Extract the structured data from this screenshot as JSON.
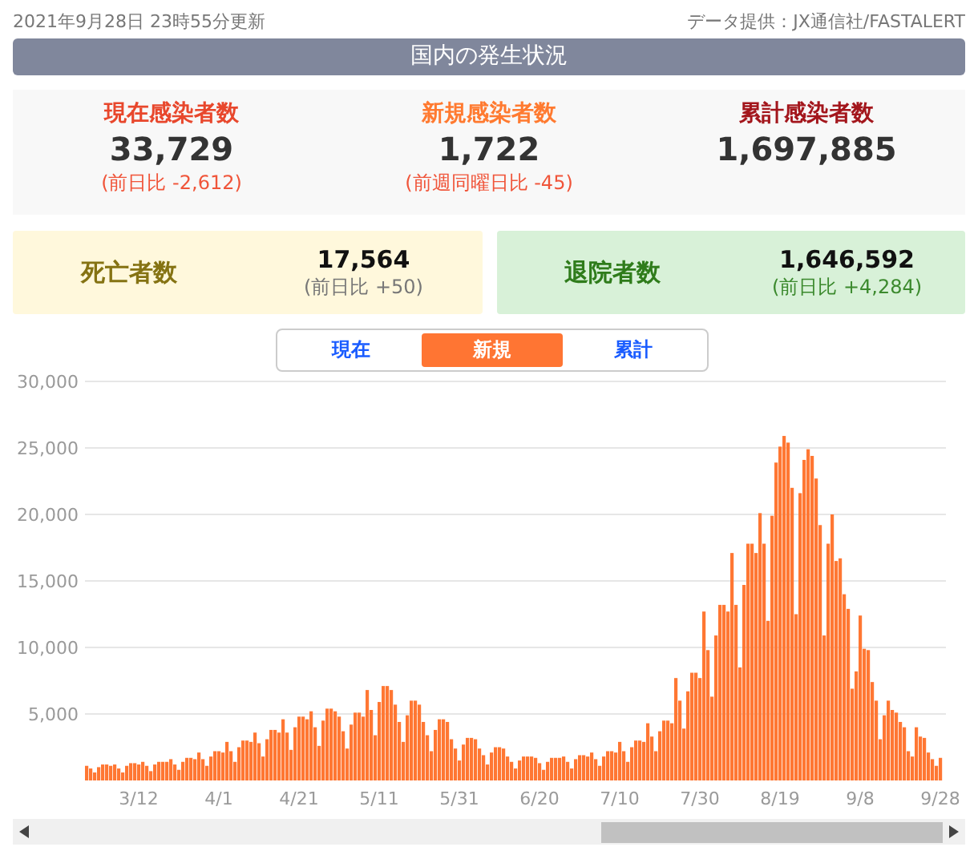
{
  "updated": "2021年9月28日 23時55分更新",
  "source": "データ提供：JX通信社/FASTALERT",
  "section_title": "国内の発生状況",
  "stats": [
    {
      "label": "現在感染者数",
      "value": "33,729",
      "delta": "(前日比 -2,612)",
      "color": "#e8472c"
    },
    {
      "label": "新規感染者数",
      "value": "1,722",
      "delta": "(前週同曜日比 -45)",
      "color": "#ff7a30"
    },
    {
      "label": "累計感染者数",
      "value": "1,697,885",
      "color": "#a3161c"
    }
  ],
  "outcomes": [
    {
      "kind": "death",
      "label": "死亡者数",
      "value": "17,564",
      "delta": "(前日比 +50)"
    },
    {
      "kind": "recovered",
      "label": "退院者数",
      "value": "1,646,592",
      "delta": "(前日比 +4,284)"
    }
  ],
  "view_tabs": [
    {
      "label": "現在",
      "selected": false
    },
    {
      "label": "新規",
      "selected": true
    },
    {
      "label": "累計",
      "selected": false
    }
  ],
  "chart": {
    "chart_data": {
      "type": "bar",
      "grid": true,
      "ylim": [
        0,
        30000
      ],
      "yticks": [
        {
          "value": 5000,
          "label": "5,000"
        },
        {
          "value": 10000,
          "label": "10,000"
        },
        {
          "value": 15000,
          "label": "15,000"
        },
        {
          "value": 20000,
          "label": "20,000"
        },
        {
          "value": 25000,
          "label": "25,000"
        },
        {
          "value": 30000,
          "label": "30,000"
        }
      ],
      "categories": [
        null,
        null,
        null,
        null,
        null,
        null,
        null,
        null,
        null,
        null,
        null,
        null,
        null,
        "3/12",
        null,
        null,
        null,
        null,
        null,
        null,
        null,
        null,
        null,
        null,
        null,
        null,
        null,
        null,
        null,
        null,
        null,
        null,
        null,
        "4/1",
        null,
        null,
        null,
        null,
        null,
        null,
        null,
        null,
        null,
        null,
        null,
        null,
        null,
        null,
        null,
        null,
        null,
        null,
        null,
        "4/21",
        null,
        null,
        null,
        null,
        null,
        null,
        null,
        null,
        null,
        null,
        null,
        null,
        null,
        null,
        null,
        null,
        null,
        null,
        null,
        "5/11",
        null,
        null,
        null,
        null,
        null,
        null,
        null,
        null,
        null,
        null,
        null,
        null,
        null,
        null,
        null,
        null,
        null,
        null,
        null,
        "5/31",
        null,
        null,
        null,
        null,
        null,
        null,
        null,
        null,
        null,
        null,
        null,
        null,
        null,
        null,
        null,
        null,
        null,
        null,
        null,
        "6/20",
        null,
        null,
        null,
        null,
        null,
        null,
        null,
        null,
        null,
        null,
        null,
        null,
        null,
        null,
        null,
        null,
        null,
        null,
        null,
        "7/10",
        null,
        null,
        null,
        null,
        null,
        null,
        null,
        null,
        null,
        null,
        null,
        null,
        null,
        null,
        null,
        null,
        null,
        null,
        null,
        "7/30",
        null,
        null,
        null,
        null,
        null,
        null,
        null,
        null,
        null,
        null,
        null,
        null,
        null,
        null,
        null,
        null,
        null,
        null,
        null,
        "8/19",
        null,
        null,
        null,
        null,
        null,
        null,
        null,
        null,
        null,
        null,
        null,
        null,
        null,
        null,
        null,
        null,
        null,
        null,
        null,
        "9/8",
        null,
        null,
        null,
        null,
        null,
        null,
        null,
        null,
        null,
        null,
        null,
        null,
        null,
        null,
        null,
        null,
        null,
        null,
        null,
        "9/28"
      ],
      "values": [
        1100,
        900,
        600,
        1000,
        1200,
        1200,
        1100,
        1200,
        900,
        600,
        1100,
        1300,
        1300,
        1200,
        1400,
        1100,
        700,
        1200,
        1400,
        1400,
        1400,
        1600,
        1200,
        800,
        1400,
        1700,
        1700,
        1600,
        2100,
        1600,
        1100,
        1800,
        2200,
        2200,
        2100,
        2900,
        2200,
        1400,
        2500,
        3000,
        3000,
        2900,
        3600,
        2800,
        1800,
        3100,
        3800,
        3800,
        3600,
        4600,
        3600,
        2300,
        4000,
        4800,
        4800,
        4600,
        5200,
        4000,
        2600,
        4500,
        5400,
        5400,
        5200,
        4800,
        3700,
        2400,
        4200,
        5100,
        5100,
        4800,
        6800,
        5300,
        3400,
        5900,
        7100,
        7100,
        6800,
        5700,
        4400,
        2900,
        4900,
        6000,
        6000,
        5700,
        4400,
        3400,
        2200,
        3800,
        4600,
        4600,
        4400,
        3100,
        2400,
        1500,
        2700,
        3200,
        3200,
        3100,
        2400,
        1900,
        1200,
        2100,
        2500,
        2500,
        2400,
        1800,
        1400,
        900,
        1500,
        1800,
        1800,
        1800,
        1700,
        1300,
        800,
        1400,
        1700,
        1700,
        1700,
        1800,
        1400,
        900,
        1600,
        1900,
        1900,
        1800,
        2100,
        1600,
        1100,
        1800,
        2200,
        2200,
        2100,
        2900,
        2200,
        1400,
        2500,
        3000,
        3000,
        2900,
        4300,
        3300,
        2200,
        3700,
        4500,
        4500,
        4300,
        7700,
        6000,
        3900,
        6700,
        8100,
        8100,
        7700,
        12700,
        9800,
        6300,
        10900,
        13200,
        13200,
        12700,
        17100,
        13200,
        8500,
        14700,
        17800,
        17800,
        17100,
        20100,
        17800,
        12000,
        19900,
        23900,
        25100,
        25900,
        25400,
        22000,
        12500,
        21600,
        24100,
        24900,
        24400,
        22700,
        19200,
        10900,
        17800,
        20000,
        16500,
        16700,
        14000,
        12900,
        6900,
        8200,
        12400,
        9900,
        9800,
        7400,
        6000,
        3100,
        4900,
        6000,
        5300,
        5100,
        4400,
        4000,
        2200,
        1800,
        4000,
        3300,
        3200,
        2100,
        1600,
        1100,
        1700
      ]
    }
  }
}
